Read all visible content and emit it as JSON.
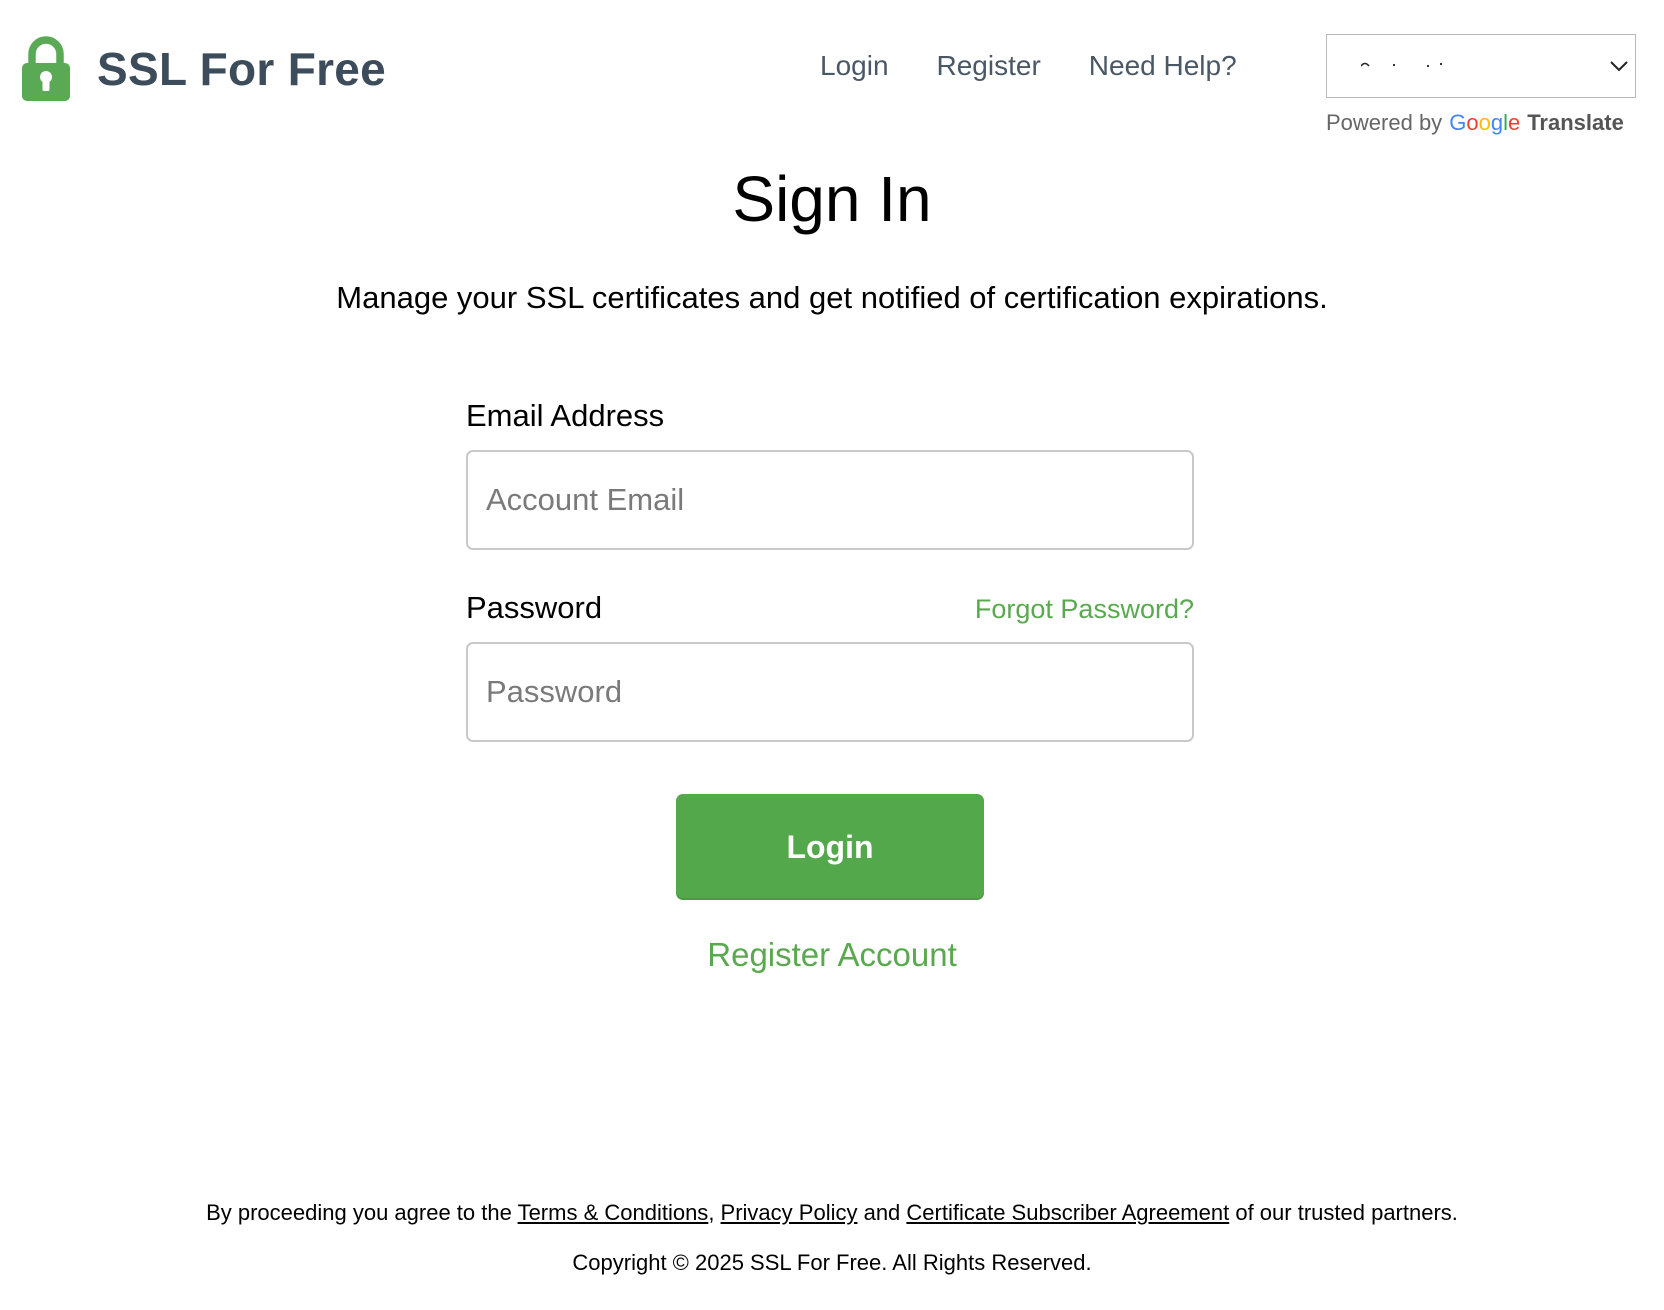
{
  "header": {
    "logo_text": "SSL For Free",
    "nav": {
      "login": "Login",
      "register": "Register",
      "help": "Need Help?"
    },
    "translate": {
      "powered_by": "Powered by",
      "google_letters": [
        "G",
        "o",
        "o",
        "g",
        "l",
        "e"
      ],
      "translate_label": "Translate"
    }
  },
  "main": {
    "title": "Sign In",
    "subtitle": "Manage your SSL certificates and get notified of certification expirations.",
    "email": {
      "label": "Email Address",
      "placeholder": "Account Email",
      "value": ""
    },
    "password": {
      "label": "Password",
      "placeholder": "Password",
      "value": "",
      "forgot": "Forgot Password?"
    },
    "login_button": "Login",
    "register_link": "Register Account"
  },
  "footer": {
    "terms_prefix": "By proceeding you agree to the ",
    "terms_link": "Terms & Conditions",
    "sep1": ", ",
    "privacy_link": "Privacy Policy",
    "sep2": " and ",
    "agreement_link": "Certificate Subscriber Agreement",
    "terms_suffix": " of our trusted partners.",
    "copyright": "Copyright © 2025 SSL For Free. All Rights Reserved."
  },
  "colors": {
    "accent_green": "#52a84a",
    "link_green": "#5aa84f",
    "brand_text": "#3d4c5a",
    "nav_text": "#4a5866"
  },
  "icons": {
    "logo": "padlock-icon",
    "select_arrow": "chevron-down-icon"
  }
}
